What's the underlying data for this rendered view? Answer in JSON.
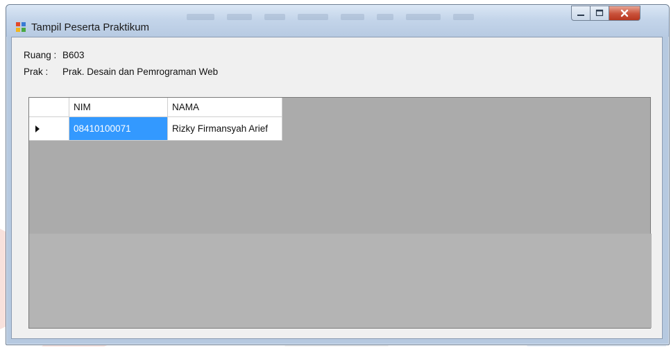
{
  "window": {
    "title": "Tampil Peserta Praktikum",
    "title_color": "#1b1b1b",
    "close_color": "#c9513a"
  },
  "info": {
    "ruang_label": "Ruang :",
    "ruang_value": "B603",
    "prak_label": "Prak :",
    "prak_value": "Prak. Desain dan Pemrograman Web"
  },
  "grid": {
    "columns": [
      "NIM",
      "NAMA"
    ],
    "rows": [
      {
        "nim": "08410100071",
        "nama": "Rizky Firmansyah Arief",
        "selected": true
      }
    ],
    "selection_color": "#3399ff",
    "background_color": "#ababab"
  },
  "icons": {
    "app": "form-window-icon",
    "row_indicator": "row-arrow-icon",
    "minimize": "minimize-icon",
    "maximize": "maximize-icon",
    "close": "close-icon"
  }
}
